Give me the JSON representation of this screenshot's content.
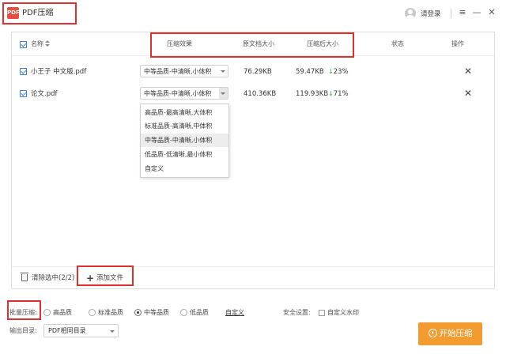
{
  "app": {
    "logo_text": "PDF",
    "title": "PDF压缩"
  },
  "account": {
    "login_label": "请登录"
  },
  "window_controls": {
    "menu_icon": "menu-icon",
    "minimize_icon": "minimize-icon",
    "close_icon": "close-icon"
  },
  "table": {
    "headers": {
      "name": "名称",
      "compression_effect": "压缩效果",
      "original_size": "原文档大小",
      "compressed_size": "压缩后大小",
      "status": "状态",
      "action": "操作"
    },
    "rows": [
      {
        "name": "小王子 中文版.pdf",
        "effect": "中等品质-中清晰,小体积",
        "original": "76.29KB",
        "compressed": "59.47KB",
        "reduction": "23%",
        "checked": true
      },
      {
        "name": "论文.pdf",
        "effect": "中等品质-中清晰,小体积",
        "original": "410.36KB",
        "compressed": "119.93KB",
        "reduction": "71%",
        "checked": true
      }
    ]
  },
  "effect_dropdown": {
    "options": [
      "高品质-最高清晰,大体积",
      "标准品质-高清晰,中体积",
      "中等品质-中清晰,小体积",
      "低品质-低清晰,最小体积",
      "自定义"
    ],
    "highlighted": "中等品质-中清晰,小体积"
  },
  "panel_footer": {
    "clear_selected": "清除选中(2/2)",
    "add_file": "添加文件"
  },
  "batch": {
    "label": "批量压缩:",
    "options": [
      "高品质",
      "标准品质",
      "中等品质",
      "低品质"
    ],
    "selected": "中等品质",
    "custom_link": "自定义"
  },
  "security": {
    "label": "安全设置:",
    "watermark_label": "自定义水印"
  },
  "output": {
    "label": "输出目录:",
    "value": "PDF相同目录"
  },
  "start_button": {
    "label": "开始压缩"
  },
  "colors": {
    "accent_orange": "#f39b2e",
    "highlight_red": "#e0302b",
    "checkbox_blue": "#3a7bd5",
    "reduction_green": "#2db04d"
  }
}
